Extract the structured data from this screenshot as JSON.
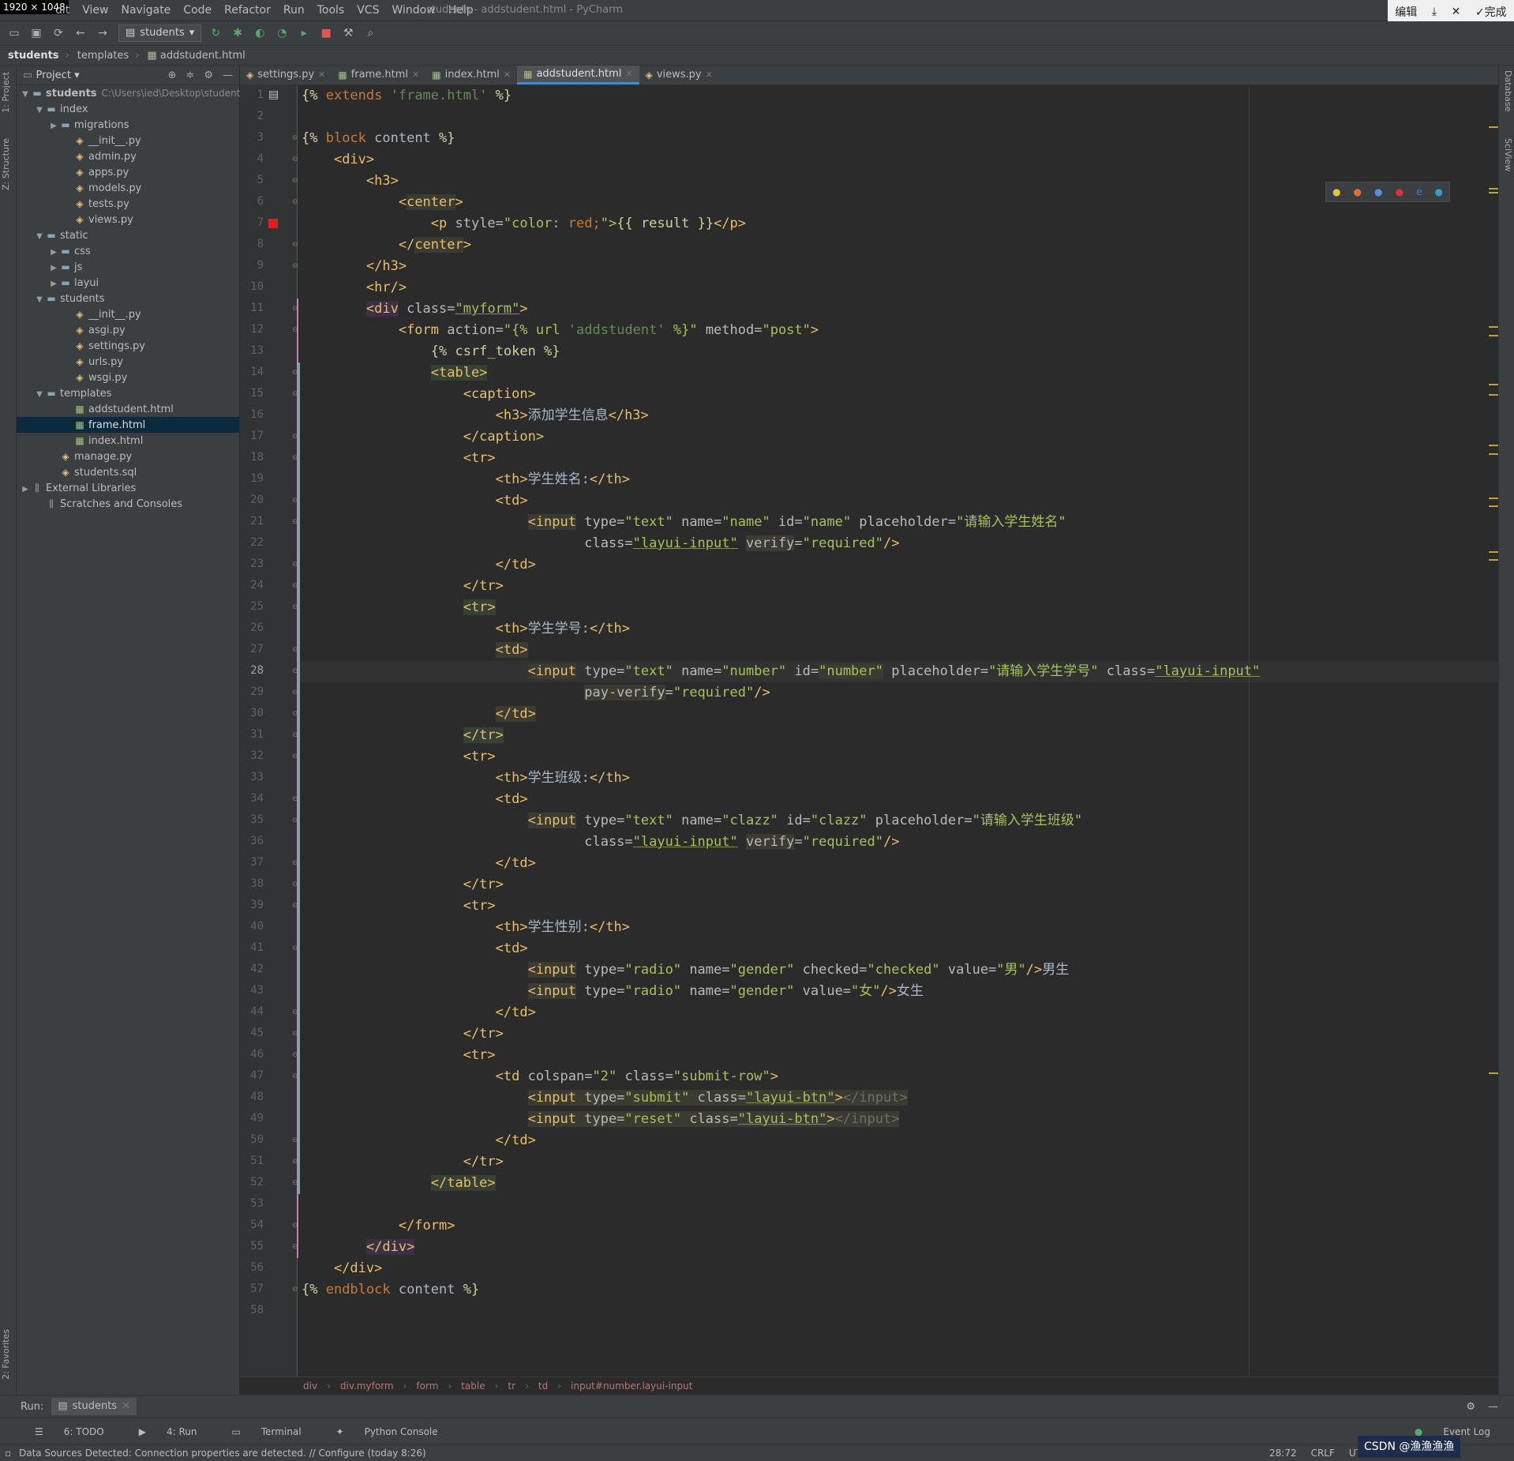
{
  "screen_badge": "1920 × 1048",
  "menubar": {
    "items": [
      "dit",
      "View",
      "Navigate",
      "Code",
      "Refactor",
      "Run",
      "Tools",
      "VCS",
      "Window",
      "Help"
    ],
    "window_title": "students - addstudent.html - PyCharm"
  },
  "ime": {
    "edit": "编辑",
    "done": "完成"
  },
  "toolbar": {
    "run_config": "students"
  },
  "navbar": {
    "root": "students",
    "folder": "templates",
    "file": "addstudent.html"
  },
  "left_strip": {
    "project_tab": "1: Project",
    "structure_tab": "Z: Structure",
    "favorites_tab": "2: Favorites"
  },
  "project": {
    "header": "Project",
    "tree": [
      {
        "depth": 0,
        "arrow": "▼",
        "icon": "folder",
        "label": "students",
        "path": "C:\\Users\\ied\\Desktop\\students",
        "bold": true
      },
      {
        "depth": 1,
        "arrow": "▼",
        "icon": "folder",
        "label": "index"
      },
      {
        "depth": 2,
        "arrow": "▶",
        "icon": "folder",
        "label": "migrations"
      },
      {
        "depth": 3,
        "arrow": "",
        "icon": "py",
        "label": "__init__.py"
      },
      {
        "depth": 3,
        "arrow": "",
        "icon": "py",
        "label": "admin.py"
      },
      {
        "depth": 3,
        "arrow": "",
        "icon": "py",
        "label": "apps.py"
      },
      {
        "depth": 3,
        "arrow": "",
        "icon": "py",
        "label": "models.py"
      },
      {
        "depth": 3,
        "arrow": "",
        "icon": "py",
        "label": "tests.py"
      },
      {
        "depth": 3,
        "arrow": "",
        "icon": "py",
        "label": "views.py"
      },
      {
        "depth": 1,
        "arrow": "▼",
        "icon": "folder",
        "label": "static"
      },
      {
        "depth": 2,
        "arrow": "▶",
        "icon": "folder",
        "label": "css"
      },
      {
        "depth": 2,
        "arrow": "▶",
        "icon": "folder",
        "label": "js"
      },
      {
        "depth": 2,
        "arrow": "▶",
        "icon": "folder",
        "label": "layui"
      },
      {
        "depth": 1,
        "arrow": "▼",
        "icon": "folder",
        "label": "students"
      },
      {
        "depth": 3,
        "arrow": "",
        "icon": "py",
        "label": "__init__.py"
      },
      {
        "depth": 3,
        "arrow": "",
        "icon": "py",
        "label": "asgi.py"
      },
      {
        "depth": 3,
        "arrow": "",
        "icon": "py",
        "label": "settings.py"
      },
      {
        "depth": 3,
        "arrow": "",
        "icon": "py",
        "label": "urls.py"
      },
      {
        "depth": 3,
        "arrow": "",
        "icon": "py",
        "label": "wsgi.py"
      },
      {
        "depth": 1,
        "arrow": "▼",
        "icon": "folder",
        "label": "templates"
      },
      {
        "depth": 3,
        "arrow": "",
        "icon": "html",
        "label": "addstudent.html"
      },
      {
        "depth": 3,
        "arrow": "",
        "icon": "html",
        "label": "frame.html",
        "selected": true
      },
      {
        "depth": 3,
        "arrow": "",
        "icon": "html",
        "label": "index.html"
      },
      {
        "depth": 2,
        "arrow": "",
        "icon": "py",
        "label": "manage.py"
      },
      {
        "depth": 2,
        "arrow": "",
        "icon": "py",
        "label": "students.sql"
      },
      {
        "depth": 0,
        "arrow": "▶",
        "icon": "lib",
        "label": "External Libraries"
      },
      {
        "depth": 1,
        "arrow": "",
        "icon": "lib",
        "label": "Scratches and Consoles"
      }
    ]
  },
  "right_strip": {
    "database": "Database",
    "sciview": "SciView"
  },
  "tabs": [
    {
      "label": "settings.py",
      "icon": "py"
    },
    {
      "label": "frame.html",
      "icon": "html"
    },
    {
      "label": "index.html",
      "icon": "html"
    },
    {
      "label": "addstudent.html",
      "icon": "html",
      "active": true
    },
    {
      "label": "views.py",
      "icon": "py"
    }
  ],
  "editor": {
    "current_line": 28,
    "line_numbers": [
      "1",
      "2",
      "3",
      "4",
      "5",
      "6",
      "7",
      "8",
      "9",
      "10",
      "11",
      "12",
      "13",
      "14",
      "15",
      "16",
      "17",
      "18",
      "19",
      "20",
      "21",
      "22",
      "23",
      "24",
      "25",
      "26",
      "27",
      "28",
      "29",
      "30",
      "31",
      "32",
      "33",
      "34",
      "35",
      "36",
      "37",
      "38",
      "39",
      "40",
      "41",
      "42",
      "43",
      "44",
      "45",
      "46",
      "47",
      "48",
      "49",
      "50",
      "51",
      "52",
      "53",
      "54",
      "55",
      "56",
      "57",
      "58"
    ],
    "lines": [
      [
        [
          "{% ",
          "dj"
        ],
        [
          "extends ",
          "k"
        ],
        [
          "'frame.html'",
          "s2"
        ],
        [
          " %}",
          "dj"
        ]
      ],
      [],
      [
        [
          "{% ",
          "dj"
        ],
        [
          "block ",
          "k"
        ],
        [
          "content",
          "tx"
        ],
        [
          " %}",
          "dj"
        ]
      ],
      [
        [
          "    "
        ],
        [
          "<div>",
          "t"
        ]
      ],
      [
        [
          "        "
        ],
        [
          "<h3>",
          "t"
        ]
      ],
      [
        [
          "            "
        ],
        [
          "<",
          "t"
        ],
        [
          "center",
          "t hl"
        ],
        [
          ">",
          "t"
        ]
      ],
      [
        [
          "                "
        ],
        [
          "<p ",
          "t"
        ],
        [
          "style=",
          "a"
        ],
        [
          "\"color: ",
          "s"
        ],
        [
          "red;",
          "k"
        ],
        [
          "\">",
          "s"
        ],
        [
          "{{ result }}",
          "dj"
        ],
        [
          "</p>",
          "t"
        ]
      ],
      [
        [
          "            "
        ],
        [
          "</",
          "t"
        ],
        [
          "center",
          "t hl"
        ],
        [
          ">",
          "t"
        ]
      ],
      [
        [
          "        "
        ],
        [
          "</h3>",
          "t"
        ]
      ],
      [
        [
          "        "
        ],
        [
          "<hr/>",
          "t"
        ]
      ],
      [
        [
          "        "
        ],
        [
          "<div",
          "t hlp"
        ],
        [
          " class=",
          "a"
        ],
        [
          "\"myform\"",
          "s u"
        ],
        [
          ">",
          "t"
        ]
      ],
      [
        [
          "            "
        ],
        [
          "<form ",
          "t"
        ],
        [
          "action=",
          "a"
        ],
        [
          "\"{% url ",
          "s"
        ],
        [
          "'addstudent'",
          "s2"
        ],
        [
          " %}\"",
          "s"
        ],
        [
          " method=",
          "a"
        ],
        [
          "\"post\"",
          "s"
        ],
        [
          ">",
          "t"
        ]
      ],
      [
        [
          "                "
        ],
        [
          "{% csrf_token %}",
          "dj"
        ]
      ],
      [
        [
          "                "
        ],
        [
          "<table>",
          "t hlt"
        ]
      ],
      [
        [
          "                    "
        ],
        [
          "<caption>",
          "t"
        ]
      ],
      [
        [
          "                        "
        ],
        [
          "<h3>",
          "t"
        ],
        [
          "添加学生信息",
          "tx"
        ],
        [
          "</h3>",
          "t"
        ]
      ],
      [
        [
          "                    "
        ],
        [
          "</caption>",
          "t"
        ]
      ],
      [
        [
          "                    "
        ],
        [
          "<tr>",
          "t"
        ]
      ],
      [
        [
          "                        "
        ],
        [
          "<th>",
          "t"
        ],
        [
          "学生姓名:",
          "tx"
        ],
        [
          "</th>",
          "t"
        ]
      ],
      [
        [
          "                        "
        ],
        [
          "<td>",
          "t"
        ]
      ],
      [
        [
          "                            "
        ],
        [
          "<input",
          "t hl"
        ],
        [
          " type=",
          "a"
        ],
        [
          "\"text\"",
          "s"
        ],
        [
          " name=",
          "a"
        ],
        [
          "\"name\"",
          "s"
        ],
        [
          " id=",
          "a"
        ],
        [
          "\"name\"",
          "s"
        ],
        [
          " placeholder=",
          "a"
        ],
        [
          "\"请输入学生姓名\"",
          "s"
        ]
      ],
      [
        [
          "                                   "
        ],
        [
          "class=",
          "a"
        ],
        [
          "\"layui-input\"",
          "s u"
        ],
        [
          " "
        ],
        [
          "verify",
          "a hl"
        ],
        [
          "=",
          "a"
        ],
        [
          "\"required\"",
          "s"
        ],
        [
          "/>",
          "t"
        ]
      ],
      [
        [
          "                        "
        ],
        [
          "</td>",
          "t"
        ]
      ],
      [
        [
          "                    "
        ],
        [
          "</tr>",
          "t"
        ]
      ],
      [
        [
          "                    "
        ],
        [
          "<tr>",
          "t hlt"
        ]
      ],
      [
        [
          "                        "
        ],
        [
          "<th>",
          "t"
        ],
        [
          "学生学号:",
          "tx"
        ],
        [
          "</th>",
          "t"
        ]
      ],
      [
        [
          "                        "
        ],
        [
          "<td>",
          "t hl"
        ]
      ],
      [
        [
          "                            "
        ],
        [
          "<input",
          "t hl"
        ],
        [
          " type=",
          "a"
        ],
        [
          "\"text\"",
          "s"
        ],
        [
          " name=",
          "a"
        ],
        [
          "\"number\"",
          "s"
        ],
        [
          " id=",
          "a"
        ],
        [
          "\"number\"",
          "s hl"
        ],
        [
          " placeholder=",
          "a"
        ],
        [
          "\"请输入学生学号\"",
          "s"
        ],
        [
          " class=",
          "a"
        ],
        [
          "\"layui-input\"",
          "s u"
        ]
      ],
      [
        [
          "                                   "
        ],
        [
          "pay-verify",
          "a hl"
        ],
        [
          "=",
          "a"
        ],
        [
          "\"required\"",
          "s"
        ],
        [
          "/>",
          "t"
        ]
      ],
      [
        [
          "                        "
        ],
        [
          "</td>",
          "t hl"
        ]
      ],
      [
        [
          "                    "
        ],
        [
          "</tr>",
          "t hlt"
        ]
      ],
      [
        [
          "                    "
        ],
        [
          "<tr>",
          "t"
        ]
      ],
      [
        [
          "                        "
        ],
        [
          "<th>",
          "t"
        ],
        [
          "学生班级:",
          "tx"
        ],
        [
          "</th>",
          "t"
        ]
      ],
      [
        [
          "                        "
        ],
        [
          "<td>",
          "t"
        ]
      ],
      [
        [
          "                            "
        ],
        [
          "<input",
          "t hl"
        ],
        [
          " type=",
          "a"
        ],
        [
          "\"text\"",
          "s"
        ],
        [
          " name=",
          "a"
        ],
        [
          "\"clazz\"",
          "s"
        ],
        [
          " id=",
          "a"
        ],
        [
          "\"clazz\"",
          "s"
        ],
        [
          " placeholder=",
          "a"
        ],
        [
          "\"请输入学生班级\"",
          "s"
        ]
      ],
      [
        [
          "                                   "
        ],
        [
          "class=",
          "a"
        ],
        [
          "\"layui-input\"",
          "s u"
        ],
        [
          " "
        ],
        [
          "verify",
          "a hl"
        ],
        [
          "=",
          "a"
        ],
        [
          "\"required\"",
          "s"
        ],
        [
          "/>",
          "t"
        ]
      ],
      [
        [
          "                        "
        ],
        [
          "</td>",
          "t"
        ]
      ],
      [
        [
          "                    "
        ],
        [
          "</tr>",
          "t"
        ]
      ],
      [
        [
          "                    "
        ],
        [
          "<tr>",
          "t"
        ]
      ],
      [
        [
          "                        "
        ],
        [
          "<th>",
          "t"
        ],
        [
          "学生性别:",
          "tx"
        ],
        [
          "</th>",
          "t"
        ]
      ],
      [
        [
          "                        "
        ],
        [
          "<td>",
          "t"
        ]
      ],
      [
        [
          "                            "
        ],
        [
          "<input",
          "t hl"
        ],
        [
          " type=",
          "a"
        ],
        [
          "\"radio\"",
          "s"
        ],
        [
          " name=",
          "a"
        ],
        [
          "\"gender\"",
          "s"
        ],
        [
          " checked=",
          "a"
        ],
        [
          "\"checked\"",
          "s"
        ],
        [
          " value=",
          "a"
        ],
        [
          "\"男\"",
          "s"
        ],
        [
          "/>",
          "t"
        ],
        [
          "男生",
          "tx"
        ]
      ],
      [
        [
          "                            "
        ],
        [
          "<input",
          "t hl"
        ],
        [
          " type=",
          "a"
        ],
        [
          "\"radio\"",
          "s"
        ],
        [
          " name=",
          "a"
        ],
        [
          "\"gender\"",
          "s"
        ],
        [
          " value=",
          "a"
        ],
        [
          "\"女\"",
          "s"
        ],
        [
          "/>",
          "t"
        ],
        [
          "女生",
          "tx"
        ]
      ],
      [
        [
          "                        "
        ],
        [
          "</td>",
          "t"
        ]
      ],
      [
        [
          "                    "
        ],
        [
          "</tr>",
          "t"
        ]
      ],
      [
        [
          "                    "
        ],
        [
          "<tr>",
          "t"
        ]
      ],
      [
        [
          "                        "
        ],
        [
          "<td ",
          "t"
        ],
        [
          "colspan=",
          "a"
        ],
        [
          "\"2\"",
          "s"
        ],
        [
          " class=",
          "a"
        ],
        [
          "\"submit-row\"",
          "s"
        ],
        [
          ">",
          "t"
        ]
      ],
      [
        [
          "                            "
        ],
        [
          "<input",
          "t hl"
        ],
        [
          " type=",
          "a hl"
        ],
        [
          "\"submit\"",
          "s hl"
        ],
        [
          " class=",
          "a hl"
        ],
        [
          "\"layui-btn\"",
          "s u hl"
        ],
        [
          ">",
          "t hl"
        ],
        [
          "</input>",
          "gr hl"
        ]
      ],
      [
        [
          "                            "
        ],
        [
          "<input",
          "t hl"
        ],
        [
          " type=",
          "a hl"
        ],
        [
          "\"reset\"",
          "s hl"
        ],
        [
          " class=",
          "a hl"
        ],
        [
          "\"layui-btn\"",
          "s u hl"
        ],
        [
          ">",
          "t hl"
        ],
        [
          "</input>",
          "gr hl"
        ]
      ],
      [
        [
          "                        "
        ],
        [
          "</td>",
          "t"
        ]
      ],
      [
        [
          "                    "
        ],
        [
          "</tr>",
          "t"
        ]
      ],
      [
        [
          "                "
        ],
        [
          "</table>",
          "t hlt"
        ]
      ],
      [],
      [
        [
          "            "
        ],
        [
          "</form>",
          "t"
        ]
      ],
      [
        [
          "        "
        ],
        [
          "</div>",
          "t hlp"
        ]
      ],
      [
        [
          "    "
        ],
        [
          "</div>",
          "t"
        ]
      ],
      [
        [
          "{% ",
          "dj"
        ],
        [
          "endblock ",
          "k"
        ],
        [
          "content",
          "tx"
        ],
        [
          " %}",
          "dj"
        ]
      ],
      []
    ]
  },
  "editor_breadcrumb": [
    "div",
    "div.myform",
    "form",
    "table",
    "tr",
    "td",
    "input#number.layui-input"
  ],
  "run_bar": {
    "label": "Run:",
    "tab": "students"
  },
  "tool_windows": [
    "6: TODO",
    "4: Run",
    "Terminal",
    "Python Console"
  ],
  "event_log": "Event Log",
  "status": {
    "message": "Data Sources Detected: Connection properties are detected. // Configure (today 8:26)",
    "position": "28:72",
    "line_sep": "CRLF",
    "encoding": "UTF-8",
    "watermark": "CSDN @渔渔渔渔"
  }
}
